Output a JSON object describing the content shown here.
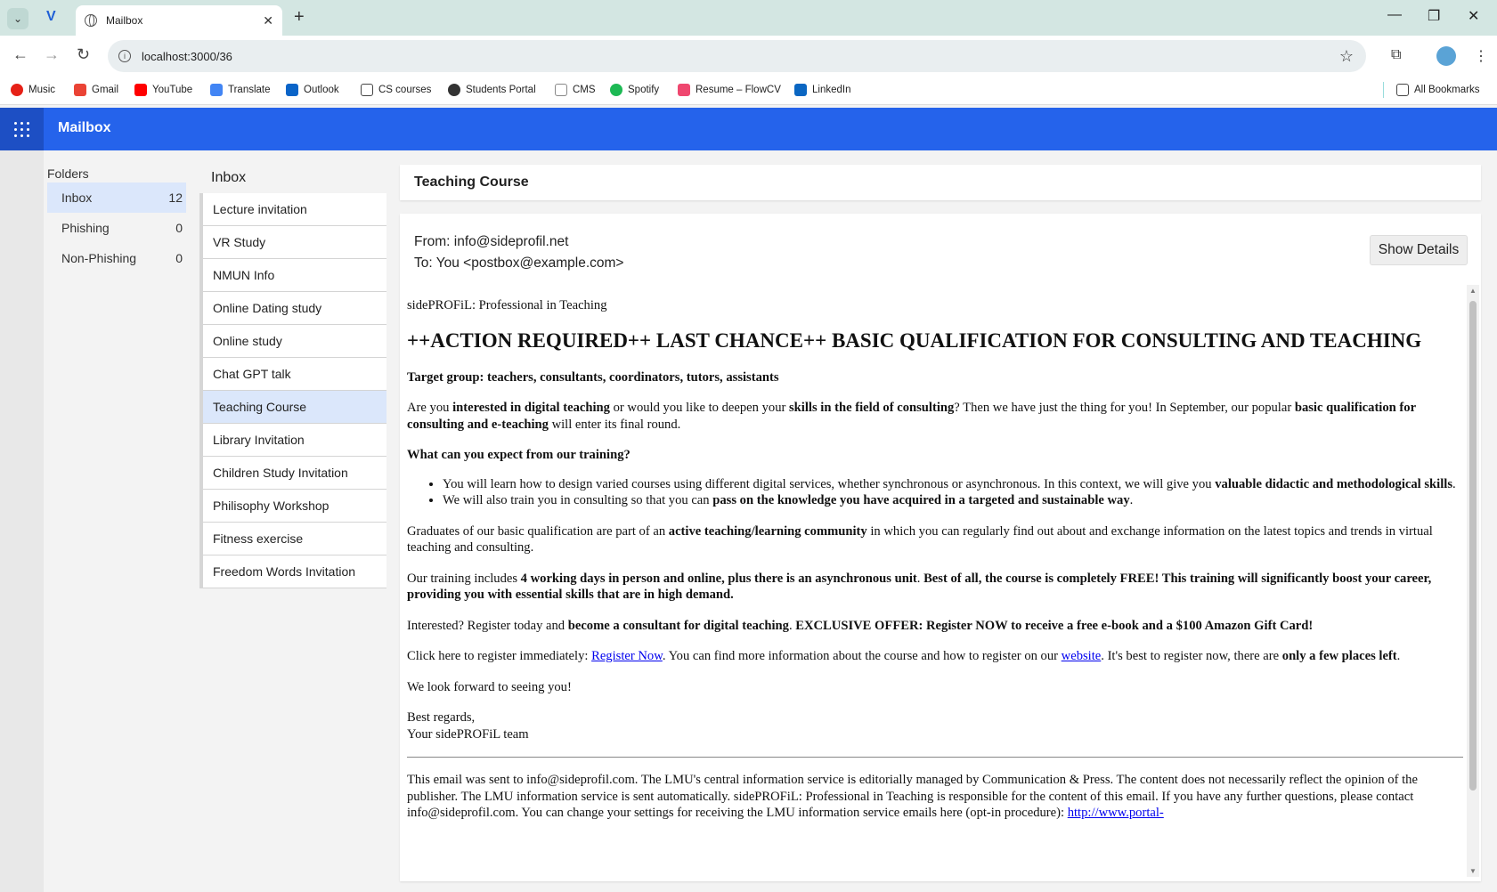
{
  "browser": {
    "tab_title": "Mailbox",
    "url": "localhost:3000/36",
    "bookmarks": [
      "Music",
      "Gmail",
      "YouTube",
      "Translate",
      "Outlook",
      "CS courses",
      "Students Portal",
      "CMS",
      "Spotify",
      "Resume – FlowCV",
      "LinkedIn"
    ],
    "all_bookmarks": "All Bookmarks"
  },
  "app": {
    "title": "Mailbox",
    "accent": "#2563eb"
  },
  "folders": {
    "title": "Folders",
    "items": [
      {
        "label": "Inbox",
        "count": "12"
      },
      {
        "label": "Phishing",
        "count": "0"
      },
      {
        "label": "Non-Phishing",
        "count": "0"
      }
    ]
  },
  "inbox": {
    "title": "Inbox",
    "items": [
      "Lecture invitation",
      "VR Study",
      "NMUN Info",
      "Online Dating study",
      "Online study",
      "Chat GPT talk",
      "Teaching Course",
      "Library Invitation",
      "Children Study Invitation",
      "Philisophy Workshop",
      "Fitness exercise",
      "Freedom Words Invitation"
    ],
    "selected": "Teaching Course"
  },
  "email": {
    "subject": "Teaching Course",
    "from": "From: info@sideprofil.net",
    "to": "To: You <postbox@example.com>",
    "show_details": "Show Details",
    "sender_line": "sidePROFiL: Professional in Teaching",
    "headline": "++ACTION REQUIRED++ LAST CHANCE++ BASIC QUALIFICATION FOR CONSULTING AND TEACHING",
    "target_group": "Target group: teachers, consultants, coordinators, tutors, assistants",
    "p1": {
      "a": "Are you ",
      "b": "interested in digital teaching",
      "c": " or would you like to deepen your ",
      "d": "skills in the field of consulting",
      "e": "? Then we have just the thing for you! In September, our popular ",
      "f": "basic qualification for consulting and e-teaching",
      "g": " will enter its final round."
    },
    "expect_heading": "What can you expect from our training?",
    "bullet1": {
      "a": "You will learn how to design varied courses using different digital services, whether synchronous or asynchronous. In this context, we will give you ",
      "b": "valuable didactic and methodological skills",
      "c": "."
    },
    "bullet2": {
      "a": "We will also train you in consulting so that you can ",
      "b": "pass on the knowledge you have acquired in a targeted and sustainable way",
      "c": "."
    },
    "p2": {
      "a": "Graduates of our basic qualification are part of an ",
      "b": "active teaching/learning community",
      "c": " in which you can regularly find out about and exchange information on the latest topics and trends in virtual teaching and consulting."
    },
    "p3": {
      "a": "Our training includes ",
      "b": "4 working days in person and online, plus there is an asynchronous unit",
      "c": ". ",
      "d": "Best of all, the course is completely FREE! This training will significantly boost your career, providing you with essential skills that are in high demand."
    },
    "p4": {
      "a": "Interested? Register today and ",
      "b": "become a consultant for digital teaching",
      "c": ". ",
      "d": "EXCLUSIVE OFFER: Register NOW to receive a free e-book and a $100 Amazon Gift Card!"
    },
    "p5": {
      "a": "Click here to register immediately: ",
      "link1": "Register Now",
      "b": ". You can find more information about the course and how to register on our ",
      "link2": "website",
      "c": ". It's best to register now, there are ",
      "d": "only a few places left",
      "e": "."
    },
    "closing": "We look forward to seeing you!",
    "regards": "Best regards,",
    "team": "Your sidePROFiL team",
    "footer_a": "This email was sent to info@sideprofil.com. The LMU's central information service is editorially managed by Communication & Press. The content does not necessarily reflect the opinion of the publisher. The LMU information service is sent automatically. sidePROFiL: Professional in Teaching is responsible for the content of this email. If you have any further questions, please contact info@sideprofil.com. You can change your settings for receiving the LMU information service emails here (opt-in procedure): ",
    "footer_link": "http://www.portal-"
  }
}
